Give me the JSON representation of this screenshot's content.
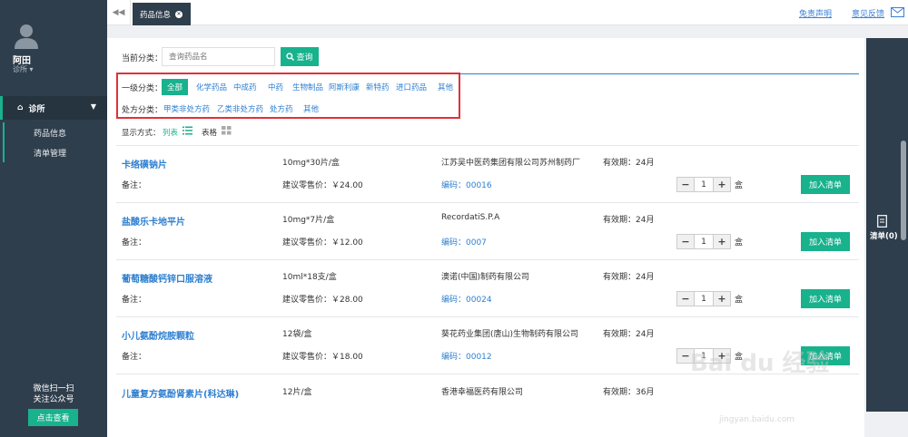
{
  "user": {
    "name": "阿田",
    "clinic": "诊所"
  },
  "sidebar": {
    "section": "诊所",
    "items": [
      {
        "label": "药品信息"
      },
      {
        "label": "清单管理"
      }
    ],
    "qr_line1": "微信扫一扫",
    "qr_line2": "关注公众号",
    "qr_button": "点击查看"
  },
  "topbar": {
    "tab": "药品信息",
    "disclaimer": "免责声明",
    "feedback": "意见反馈"
  },
  "search": {
    "label": "当前分类：",
    "placeholder": "查询药品名",
    "button": "查询"
  },
  "categories": {
    "level1_label": "一级分类：",
    "level1": [
      "全部",
      "化学药品",
      "中成药",
      "中药",
      "生物制品",
      "阿斯利康",
      "新特药",
      "进口药品",
      "其他"
    ],
    "rx_label": "处方分类：",
    "rx": [
      "甲类非处方药",
      "乙类非处方药",
      "处方药",
      "其他"
    ]
  },
  "display": {
    "label": "显示方式：",
    "list": "列表",
    "table": "表格"
  },
  "products": [
    {
      "name": "卡络磺钠片",
      "spec": "10mg*30片/盒",
      "maker": "江苏吴中医药集团有限公司苏州制药厂",
      "validity": "有效期：24月",
      "note": "备注：",
      "price": "建议零售价：￥24.00",
      "code": "编码：00016",
      "qty": "1",
      "unit": "盒"
    },
    {
      "name": "盐酸乐卡地平片",
      "spec": "10mg*7片/盒",
      "maker": "RecordatiS.P.A",
      "validity": "有效期：24月",
      "note": "备注：",
      "price": "建议零售价：￥12.00",
      "code": "编码：0007",
      "qty": "1",
      "unit": "盒"
    },
    {
      "name": "葡萄糖酸钙锌口服溶液",
      "spec": "10ml*18支/盒",
      "maker": "澳诺(中国)制药有限公司",
      "validity": "有效期：24月",
      "note": "备注：",
      "price": "建议零售价：￥28.00",
      "code": "编码：00024",
      "qty": "1",
      "unit": "盒"
    },
    {
      "name": "小儿氨酚烷胺颗粒",
      "spec": "12袋/盒",
      "maker": "葵花药业集团(唐山)生物制药有限公司",
      "validity": "有效期：24月",
      "note": "备注：",
      "price": "建议零售价：￥18.00",
      "code": "编码：00012",
      "qty": "1",
      "unit": "盒"
    },
    {
      "name": "儿童复方氨酚肾素片(科达琳)",
      "spec": "12片/盒",
      "maker": "香港幸福医药有限公司",
      "validity": "有效期：36月"
    }
  ],
  "add_button": "加入清单",
  "cart": {
    "label": "清单(0)"
  },
  "watermark": {
    "text": "Bai du 经验",
    "url": "jingyan.baidu.com"
  },
  "colors": {
    "accent": "#18b28d",
    "sidebar": "#2f3e4c",
    "link": "#2e7fd0",
    "highlight_border": "#e03138"
  }
}
